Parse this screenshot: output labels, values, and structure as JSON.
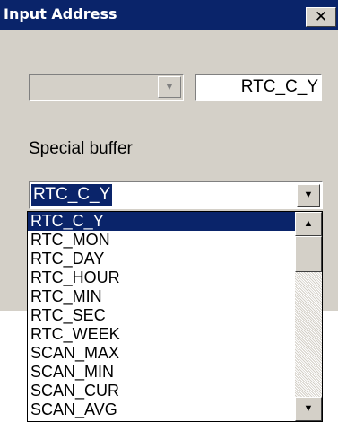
{
  "window": {
    "title": "Input Address",
    "close_glyph": "✕"
  },
  "address": {
    "value": "RTC_C_Y"
  },
  "special_buffer": {
    "label": "Special buffer",
    "selected": "RTC_C_Y",
    "options": [
      "RTC_C_Y",
      "RTC_MON",
      "RTC_DAY",
      "RTC_HOUR",
      "RTC_MIN",
      "RTC_SEC",
      "RTC_WEEK",
      "SCAN_MAX",
      "SCAN_MIN",
      "SCAN_CUR",
      "SCAN_AVG"
    ],
    "selected_index": 0
  },
  "icons": {
    "dropdown_arrow": "chevron-down-icon",
    "scroll_up": "arrow-up-icon",
    "scroll_down": "arrow-down-icon"
  },
  "colors": {
    "titlebar": "#0a246a",
    "dialog_bg": "#d4d0c8",
    "selection": "#0a246a"
  }
}
